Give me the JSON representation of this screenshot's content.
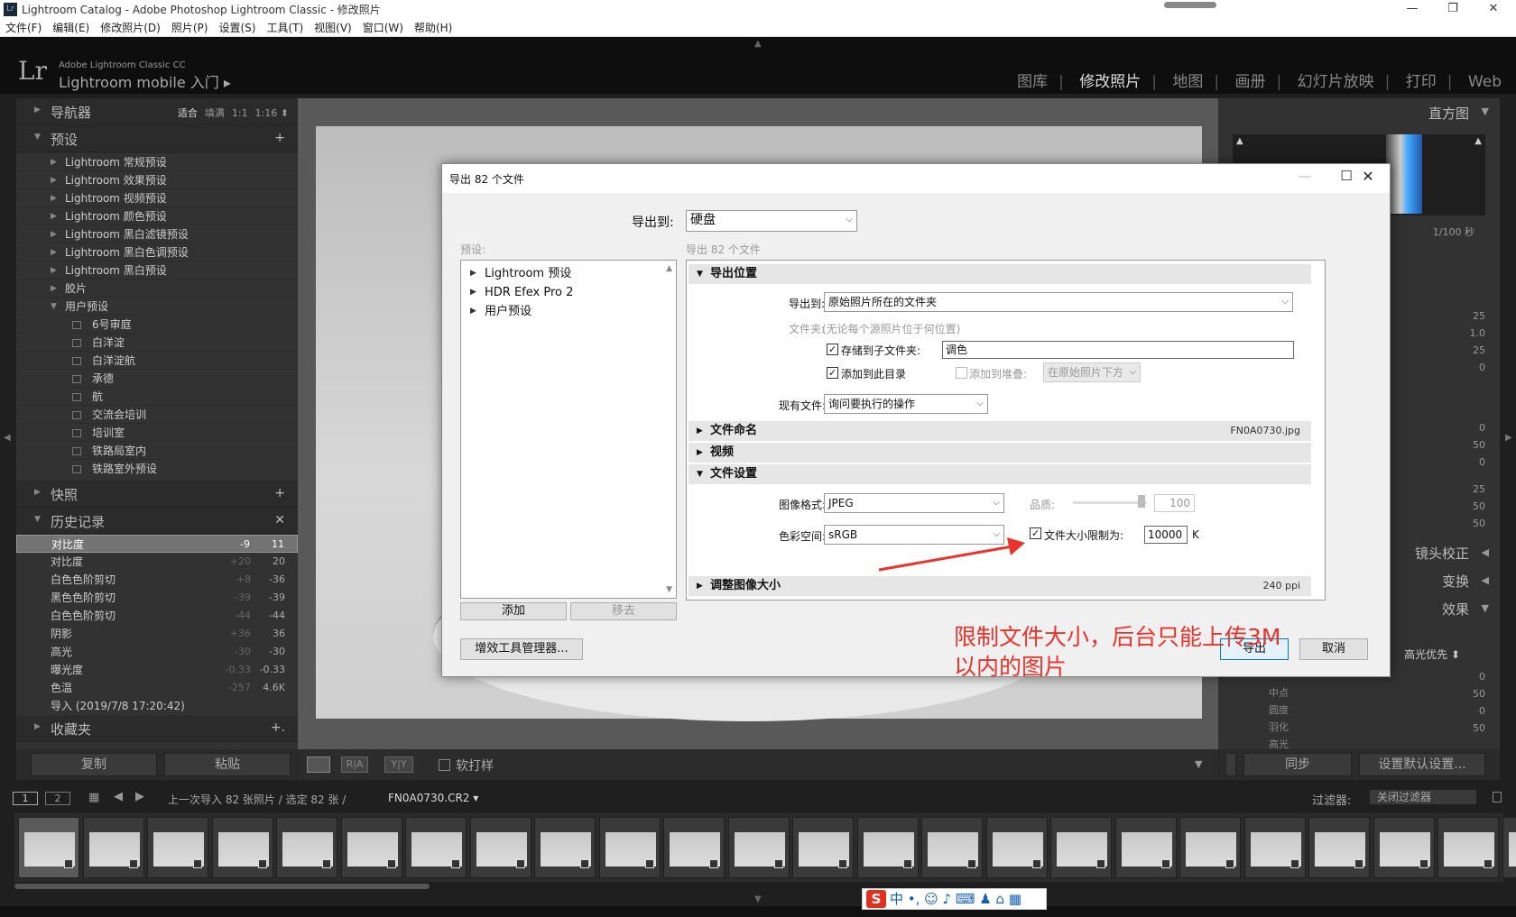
{
  "window": {
    "title": "Lightroom Catalog - Adobe Photoshop Lightroom Classic - 修改照片",
    "minimize": "—",
    "maximize": "❐",
    "close": "✕"
  },
  "menu": [
    "文件(F)",
    "编辑(E)",
    "修改照片(D)",
    "照片(P)",
    "设置(S)",
    "工具(T)",
    "视图(V)",
    "窗口(W)",
    "帮助(H)"
  ],
  "identity": {
    "logo": "Lr",
    "sub": "Adobe Lightroom Classic CC",
    "main": "Lightroom mobile 入门 ▸"
  },
  "modules": [
    "图库",
    "修改照片",
    "地图",
    "画册",
    "幻灯片放映",
    "打印",
    "Web"
  ],
  "left_panel": {
    "navigator": {
      "label": "导航器",
      "modes": [
        "适合",
        "填满",
        "1:1",
        "1:16 ⬍"
      ]
    },
    "presets": {
      "label": "预设",
      "add": "+",
      "groups": [
        "Lightroom 常规预设",
        "Lightroom 效果预设",
        "Lightroom 视频预设",
        "Lightroom 颜色预设",
        "Lightroom 黑白滤镜预设",
        "Lightroom 黑白色调预设",
        "Lightroom 黑白预设",
        "胶片"
      ],
      "user_group": "用户预设",
      "user_items": [
        "6号审庭",
        "白洋淀",
        "白洋淀航",
        "承德",
        "航",
        "交流会培训",
        "培训室",
        "铁路局室内",
        "铁路室外预设"
      ]
    },
    "snapshots": {
      "label": "快照",
      "add": "+"
    },
    "history": {
      "label": "历史记录",
      "close": "✕",
      "rows": [
        {
          "name": "对比度",
          "a": "-9",
          "b": "11"
        },
        {
          "name": "对比度",
          "a": "+20",
          "b": "20"
        },
        {
          "name": "白色色阶剪切",
          "a": "+8",
          "b": "-36"
        },
        {
          "name": "黑色色阶剪切",
          "a": "-39",
          "b": "-39"
        },
        {
          "name": "白色色阶剪切",
          "a": "-44",
          "b": "-44"
        },
        {
          "name": "阴影",
          "a": "+36",
          "b": "36"
        },
        {
          "name": "高光",
          "a": "-30",
          "b": "-30"
        },
        {
          "name": "曝光度",
          "a": "-0.33",
          "b": "-0.33"
        },
        {
          "name": "色温",
          "a": "-257",
          "b": "4.6K"
        },
        {
          "name": "导入 (2019/7/8 17:20:42)",
          "a": "",
          "b": ""
        }
      ]
    },
    "collections": {
      "label": "收藏夹",
      "add": "+."
    },
    "copy": "复制",
    "paste": "粘贴"
  },
  "toolbar": {
    "soft_proof": "软打样",
    "view_ra": "R|A",
    "view_yy": "Y|Y"
  },
  "right_panel": {
    "histogram_label": "直方图",
    "hist_left": ".0",
    "hist_right": "1/100 秒",
    "values1": [
      "25",
      "1.0",
      "25",
      "0"
    ],
    "values2": [
      "0",
      "50",
      "0"
    ],
    "values3": [
      "25",
      "50",
      "50"
    ],
    "lens": "镜头校正",
    "transform": "变换",
    "effects": "效果",
    "priority": "高光优先 ⬍",
    "effects_values": [
      "0",
      "50",
      "0",
      "50"
    ],
    "effects_labels": [
      "中点",
      "圆度",
      "羽化",
      "高光"
    ],
    "sync": "同步",
    "reset": "设置默认设置..."
  },
  "filmbar": {
    "page1": "1",
    "page2": "2",
    "path": "上一次导入  82 张照片 / 选定 82 张 /",
    "file": "FN0A0730.CR2 ▾",
    "filter_label": "过滤器:",
    "filter_value": "关闭过滤器"
  },
  "dialog": {
    "title": "导出 82 个文件",
    "export_to_label": "导出到:",
    "export_to_value": "硬盘",
    "preset_label": "预设:",
    "count_label": "导出 82 个文件",
    "presets": [
      "Lightroom 预设",
      "HDR Efex Pro 2",
      "用户预设"
    ],
    "add_btn": "添加",
    "remove_btn": "移去",
    "plugin_btn": "增效工具管理器...",
    "export_btn": "导出",
    "cancel_btn": "取消",
    "location": {
      "header": "导出位置",
      "export_to_label": "导出到:",
      "export_to_value": "原始照片所在的文件夹",
      "folder_label": "文件夹:",
      "folder_hint": "(无论每个源照片位于何位置)",
      "subfolder_label": "存储到子文件夹:",
      "subfolder_value": "调色",
      "add_catalog_label": "添加到此目录",
      "add_stack_label": "添加到堆叠:",
      "stack_value": "在原始照片下方",
      "existing_label": "现有文件:",
      "existing_value": "询问要执行的操作"
    },
    "naming": {
      "header": "文件命名",
      "value": "FN0A0730.jpg"
    },
    "video": {
      "header": "视频"
    },
    "file_settings": {
      "header": "文件设置",
      "format_label": "图像格式:",
      "format_value": "JPEG",
      "quality_label": "品质:",
      "quality_value": "100",
      "colorspace_label": "色彩空间:",
      "colorspace_value": "sRGB",
      "limit_label": "文件大小限制为:",
      "limit_value": "10000",
      "limit_unit": "K"
    },
    "resize": {
      "header": "调整图像大小",
      "value": "240 ppi"
    }
  },
  "annotation": {
    "line1": "限制文件大小，后台只能上传3M",
    "line2": "以内的图片",
    "color": "#e8342c"
  },
  "ime": {
    "logo": "S",
    "text": "中 •, ☺ ♪ ⌨ ♟ ⌂ ▦"
  }
}
